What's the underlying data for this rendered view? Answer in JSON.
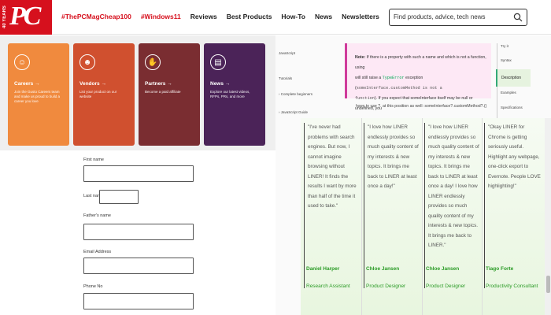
{
  "header": {
    "logo_badge": "40 YEARS",
    "logo_text": "PC",
    "nav": [
      {
        "label": "#ThePCMagCheap100",
        "red": true
      },
      {
        "label": "#Windows11",
        "red": true
      },
      {
        "label": "Reviews",
        "red": false
      },
      {
        "label": "Best Products",
        "red": false
      },
      {
        "label": "How-To",
        "red": false
      },
      {
        "label": "News",
        "red": false
      },
      {
        "label": "Newsletters",
        "red": false
      }
    ],
    "search_placeholder": "Find products, advice, tech news"
  },
  "cards": [
    {
      "title": "Careers →",
      "desc": "Join the Gusto Careers team and make us proud to build a career you love",
      "color": "#f08a3e"
    },
    {
      "title": "Vendors →",
      "desc": "List your product on our website",
      "color": "#d0502f"
    },
    {
      "title": "Partners →",
      "desc": "Become a paid affiliate",
      "color": "#7a2d31"
    },
    {
      "title": "News →",
      "desc": "Explore our latest videos, RFPs, PRs, and more",
      "color": "#4b2358"
    }
  ],
  "form": {
    "first_name": "First name",
    "last_name": "Last name",
    "fathers_name": "Father's name",
    "email": "Email Address",
    "phone": "Phone No"
  },
  "docs": {
    "crumb": "JavaScript",
    "tutorials": "Tutorials",
    "complete_beginners": "Complete beginners",
    "js_guide": "JavaScript Guide",
    "note_label": "Note:",
    "note_line1": "If there is a property with such a name and which is not a function, using",
    "note_line2_pre": "will still raise a",
    "note_typeerror": "TypeError",
    "note_line2_mid": "exception (",
    "note_code": "someInterface.customMethod is not a",
    "note_line3_code": "function",
    "note_line3": "). If you expect that someInterface itself may be null or undefined, you",
    "note_line4": "have to use ?. at this position as well: someInterface?.customMethod?.()",
    "toc": [
      "Try it",
      "Syntax",
      "Description",
      "Examples",
      "Specifications"
    ]
  },
  "reviews": [
    {
      "quote": "\"I've never had problems with search engines. But now, I cannot imagine browsing without LINER! It finds the results I want by more than half of the time it used to take.\"",
      "name": "Daniel Harper",
      "role": "Research Assistant"
    },
    {
      "quote": "\"I love how LINER endlessly provides so much quality content of my interests & new topics. It brings me back to LINER at least once a day!\"",
      "name": "Chloe Jansen",
      "role": "Product Designer"
    },
    {
      "quote": "\"I love how LINER endlessly provides so much quality content of my interests & new topics. It brings me back to LINER at least once a day! I love how LINER endlessly provides so much quality content of my interests & new topics. It brings me back to LINER.\"",
      "name": "Chloe Jansen",
      "role": "Product Designer"
    },
    {
      "quote": "\"Okay LINER for Chrome is getting seriously useful. Highlight any webpage, one-click export to Evernote. People LOVE highlighting!\"",
      "name": "Tiago Forte",
      "role": "Productivity Consultant"
    }
  ]
}
